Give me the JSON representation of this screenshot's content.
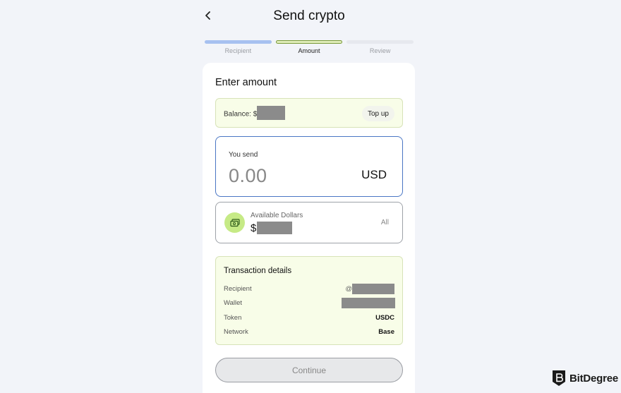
{
  "header": {
    "back_icon": "chevron-left-icon",
    "title": "Send crypto"
  },
  "steps": [
    {
      "label": "Recipient",
      "state": "done"
    },
    {
      "label": "Amount",
      "state": "active"
    },
    {
      "label": "Review",
      "state": "todo"
    }
  ],
  "card": {
    "title": "Enter amount",
    "balance": {
      "label": "Balance: $",
      "topup_label": "Top up"
    },
    "send": {
      "label": "You send",
      "amount": "0.00",
      "currency": "USD"
    },
    "available": {
      "icon": "cash-icon",
      "label": "Available Dollars",
      "prefix": "$",
      "all_label": "All"
    },
    "transaction": {
      "title": "Transaction details",
      "rows": [
        {
          "key": "Recipient",
          "prefix": "@",
          "value": ""
        },
        {
          "key": "Wallet",
          "prefix": "",
          "value": ""
        },
        {
          "key": "Token",
          "prefix": "",
          "value": "USDC"
        },
        {
          "key": "Network",
          "prefix": "",
          "value": "Base"
        }
      ]
    },
    "continue_label": "Continue"
  },
  "watermark": {
    "text": "BitDegree"
  },
  "colors": {
    "background": "#f2f4f9",
    "accent_blue": "#4a76c4",
    "light_green": "#f8fde8",
    "icon_green": "#c6ea86"
  }
}
